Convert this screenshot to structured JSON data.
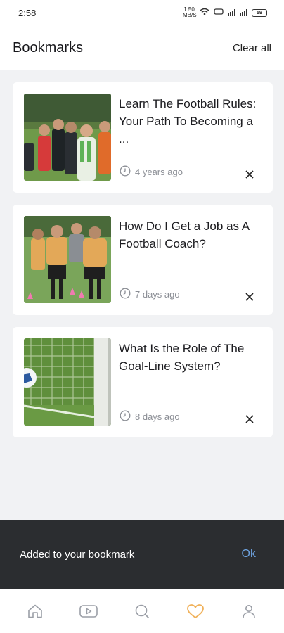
{
  "status": {
    "time": "2:58",
    "speed": "1.50 MB/S",
    "battery": "59"
  },
  "header": {
    "title": "Bookmarks",
    "clear_label": "Clear all"
  },
  "bookmarks": [
    {
      "title": "Learn The Football Rules: Your Path To Becoming a ...",
      "time": "4 years ago",
      "thumb": "referee-players"
    },
    {
      "title": "How Do I Get a Job as A Football Coach?",
      "time": "7 days ago",
      "thumb": "training-players"
    },
    {
      "title": "What Is the Role of The Goal-Line System?",
      "time": "8 days ago",
      "thumb": "goal-net"
    }
  ],
  "snackbar": {
    "message": "Added to your bookmark",
    "action": "Ok"
  },
  "tabs": [
    {
      "icon": "home-icon",
      "active": false
    },
    {
      "icon": "video-icon",
      "active": false
    },
    {
      "icon": "search-icon",
      "active": false
    },
    {
      "icon": "heart-icon",
      "active": true
    },
    {
      "icon": "profile-icon",
      "active": false
    }
  ],
  "colors": {
    "active_tab": "#f0b15a",
    "inactive_tab": "#9a9ea6",
    "snackbar_bg": "#2b2d30",
    "snackbar_action": "#6ea3e0"
  }
}
